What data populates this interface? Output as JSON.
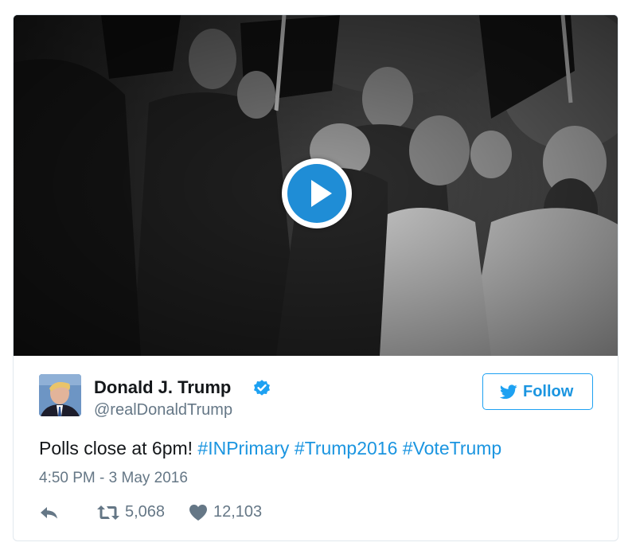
{
  "tweet": {
    "author_name": "Donald J. Trump",
    "author_handle": "@realDonaldTrump",
    "follow_label": "Follow",
    "text_plain": "Polls close at 6pm!",
    "hashtags": [
      "#INPrimary",
      "#Trump2016",
      "#VoteTrump"
    ],
    "timestamp": "4:50 PM - 3 May 2016",
    "retweets": "5,068",
    "likes": "12,103"
  },
  "icons": {
    "play": "play-icon",
    "verified": "verified-badge-icon",
    "bird": "twitter-bird-icon",
    "reply": "reply-icon",
    "retweet": "retweet-icon",
    "like": "heart-icon"
  },
  "colors": {
    "link_blue": "#1b95e0",
    "play_blue": "#1f8dd6",
    "muted_gray": "#657786",
    "border": "#e1e8ed"
  }
}
